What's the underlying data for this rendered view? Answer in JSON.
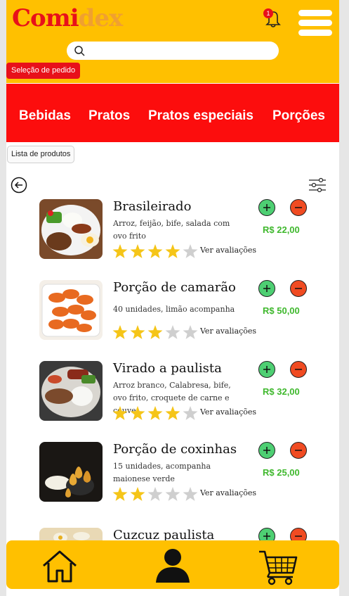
{
  "header": {
    "logo_part1": "Comi",
    "logo_part2": "dex",
    "notification_count": "1",
    "search_placeholder": ""
  },
  "section_tag": "Seleção de pedido",
  "categories": [
    "Bebidas",
    "Pratos",
    "Pratos especiais",
    "Porções"
  ],
  "list_tag": "Lista de produtos",
  "items": [
    {
      "name": "Brasileirado",
      "desc": "Arroz, feijão, bife, salada com ovo frito",
      "price": "R$ 22,00",
      "rating": 4,
      "reviews": "Ver avaliações"
    },
    {
      "name": "Porção de camarão",
      "desc": "40 unidades, limão acompanha",
      "price": "R$ 50,00",
      "rating": 3,
      "reviews": "Ver avaliações"
    },
    {
      "name": "Virado a paulista",
      "desc": "Arroz branco, Calabresa, bife, ovo frito, croquete de carne e couve.",
      "price": "R$ 32,00",
      "rating": 4,
      "reviews": "Ver avaliações"
    },
    {
      "name": "Porção de coxinhas",
      "desc": "15 unidades, acompanha maionese verde",
      "price": "R$ 25,00",
      "rating": 2,
      "reviews": "Ver avaliações"
    },
    {
      "name": "Cuzcuz paulista",
      "desc": "",
      "price": "",
      "rating": 0,
      "reviews": ""
    }
  ],
  "bottom_nav": [
    "home-icon",
    "profile-icon",
    "cart-icon"
  ],
  "colors": {
    "accent": "#FFC000",
    "red": "#fc0d0d",
    "price": "#3fb82d",
    "star": "#f5c518"
  }
}
